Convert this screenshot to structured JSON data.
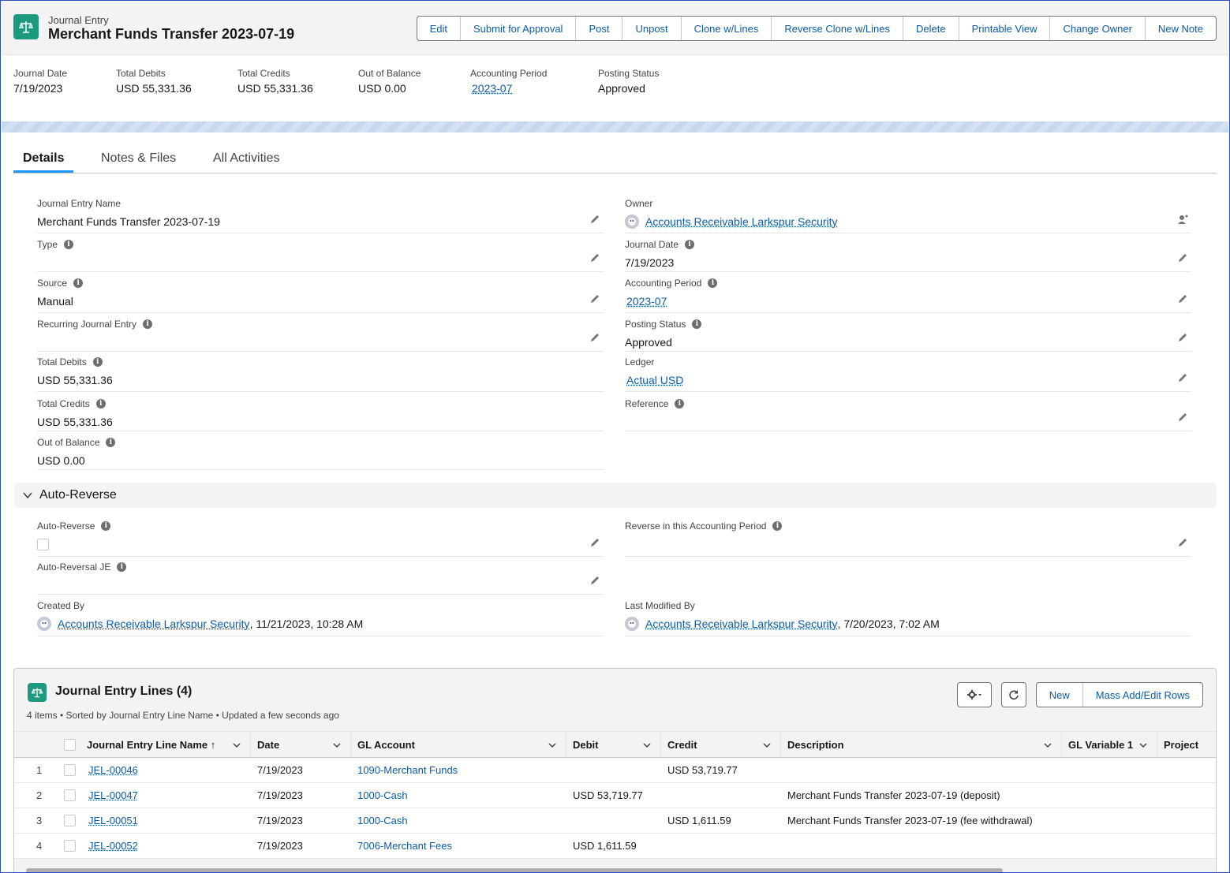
{
  "header": {
    "object_label": "Journal Entry",
    "title": "Merchant Funds Transfer 2023-07-19",
    "actions": [
      "Edit",
      "Submit for Approval",
      "Post",
      "Unpost",
      "Clone w/Lines",
      "Reverse Clone w/Lines",
      "Delete",
      "Printable View",
      "Change Owner",
      "New Note"
    ]
  },
  "highlights": [
    {
      "label": "Journal Date",
      "value": "7/19/2023"
    },
    {
      "label": "Total Debits",
      "value": "USD 55,331.36"
    },
    {
      "label": "Total Credits",
      "value": "USD 55,331.36"
    },
    {
      "label": "Out of Balance",
      "value": "USD 0.00"
    },
    {
      "label": "Accounting Period",
      "value": "2023-07"
    },
    {
      "label": "Posting Status",
      "value": "Approved"
    }
  ],
  "tabs": [
    "Details",
    "Notes & Files",
    "All Activities"
  ],
  "details": {
    "left": [
      {
        "label": "Journal Entry Name",
        "value": "Merchant Funds Transfer 2023-07-19"
      },
      {
        "label": "Type",
        "value": ""
      },
      {
        "label": "Source",
        "value": "Manual"
      },
      {
        "label": "Recurring Journal Entry",
        "value": ""
      },
      {
        "label": "Total Debits",
        "value": "USD 55,331.36"
      },
      {
        "label": "Total Credits",
        "value": "USD 55,331.36"
      },
      {
        "label": "Out of Balance",
        "value": "USD 0.00"
      }
    ],
    "right": [
      {
        "label": "Owner",
        "value": "Accounts Receivable Larkspur Security"
      },
      {
        "label": "Journal Date",
        "value": "7/19/2023"
      },
      {
        "label": "Accounting Period",
        "value": "2023-07"
      },
      {
        "label": "Posting Status",
        "value": "Approved"
      },
      {
        "label": "Ledger",
        "value": "Actual USD"
      },
      {
        "label": "Reference",
        "value": ""
      }
    ]
  },
  "auto_reverse": {
    "section_title": "Auto-Reverse",
    "auto_reverse_label": "Auto-Reverse",
    "auto_reverse_checked": false,
    "reverse_period_label": "Reverse in this Accounting Period",
    "reversal_je_label": "Auto-Reversal JE",
    "created_by_label": "Created By",
    "created_by_user": "Accounts Receivable Larkspur Security",
    "created_by_date": ", 11/21/2023, 10:28 AM",
    "modified_by_label": "Last Modified By",
    "modified_by_user": "Accounts Receivable Larkspur Security",
    "modified_by_date": ", 7/20/2023, 7:02 AM"
  },
  "lines": {
    "title": "Journal Entry Lines (4)",
    "subtitle": "4 items • Sorted by Journal Entry Line Name • Updated a few seconds ago",
    "new_label": "New",
    "mass_label": "Mass Add/Edit Rows",
    "columns": [
      "Journal Entry Line Name",
      "Date",
      "GL Account",
      "Debit",
      "Credit",
      "Description",
      "GL Variable 1",
      "Project"
    ],
    "sort_indicator": "↑",
    "rows": [
      {
        "num": "1",
        "name": "JEL-00046",
        "date": "7/19/2023",
        "gl": "1090-Merchant Funds",
        "debit": "",
        "credit": "USD 53,719.77",
        "desc": ""
      },
      {
        "num": "2",
        "name": "JEL-00047",
        "date": "7/19/2023",
        "gl": "1000-Cash",
        "debit": "USD 53,719.77",
        "credit": "",
        "desc": "Merchant Funds Transfer 2023-07-19 (deposit)"
      },
      {
        "num": "3",
        "name": "JEL-00051",
        "date": "7/19/2023",
        "gl": "1000-Cash",
        "debit": "",
        "credit": "USD 1,611.59",
        "desc": "Merchant Funds Transfer 2023-07-19 (fee withdrawal)"
      },
      {
        "num": "4",
        "name": "JEL-00052",
        "date": "7/19/2023",
        "gl": "7006-Merchant Fees",
        "debit": "USD 1,611.59",
        "credit": "",
        "desc": ""
      }
    ]
  },
  "colors": {
    "brand": "#1c9a80",
    "link": "#0b5cab",
    "accent": "#1b96ff"
  }
}
